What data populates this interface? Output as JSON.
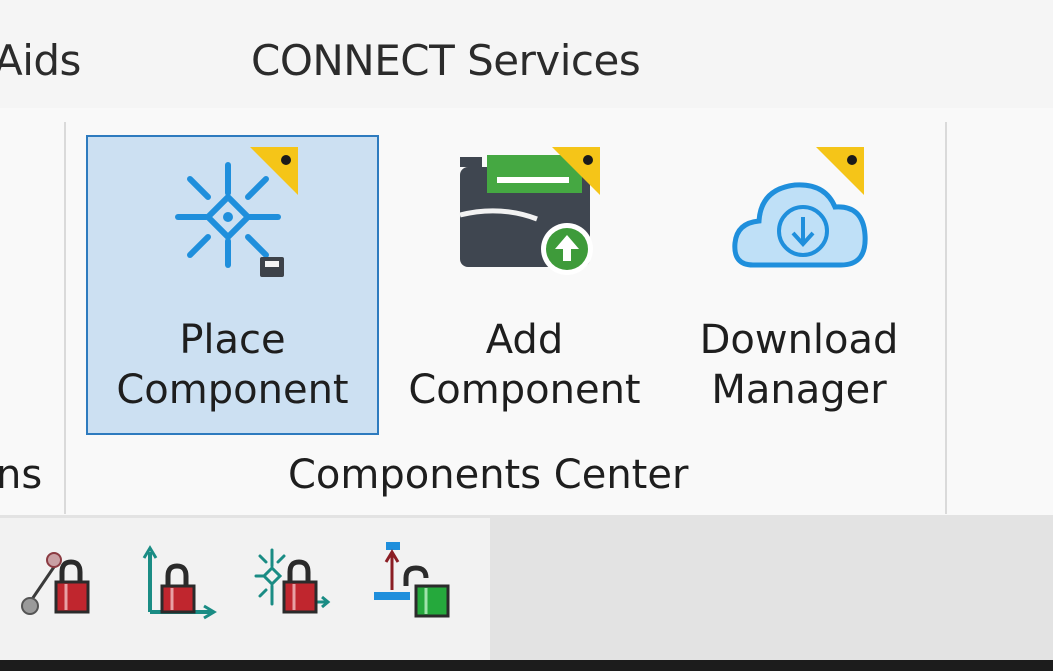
{
  "tabs": {
    "partial_tab": "Aids",
    "connect_services": "CONNECT Services"
  },
  "ribbon": {
    "left_partial_group_label": "ns",
    "group_label": "Components Center",
    "buttons": [
      {
        "line1": "Place",
        "line2": "Component",
        "icon": "place-component-icon",
        "active": true
      },
      {
        "line1": "Add",
        "line2": "Component",
        "icon": "add-component-icon",
        "active": false
      },
      {
        "line1": "Download",
        "line2": "Manager",
        "icon": "download-cloud-icon",
        "active": false
      }
    ]
  },
  "lower_toolbar": {
    "icons": [
      "lock-pivot-icon",
      "lock-axis-icon",
      "lock-snap-icon",
      "lock-unlock-icon"
    ]
  },
  "colors": {
    "accent_blue": "#1f8fdc",
    "active_bg": "#cce0f2",
    "active_border": "#2e7bbf",
    "corner_yellow": "#f5c518",
    "add_green": "#3e9b3a",
    "lock_red": "#c0262e",
    "lock_green": "#25a93c"
  }
}
